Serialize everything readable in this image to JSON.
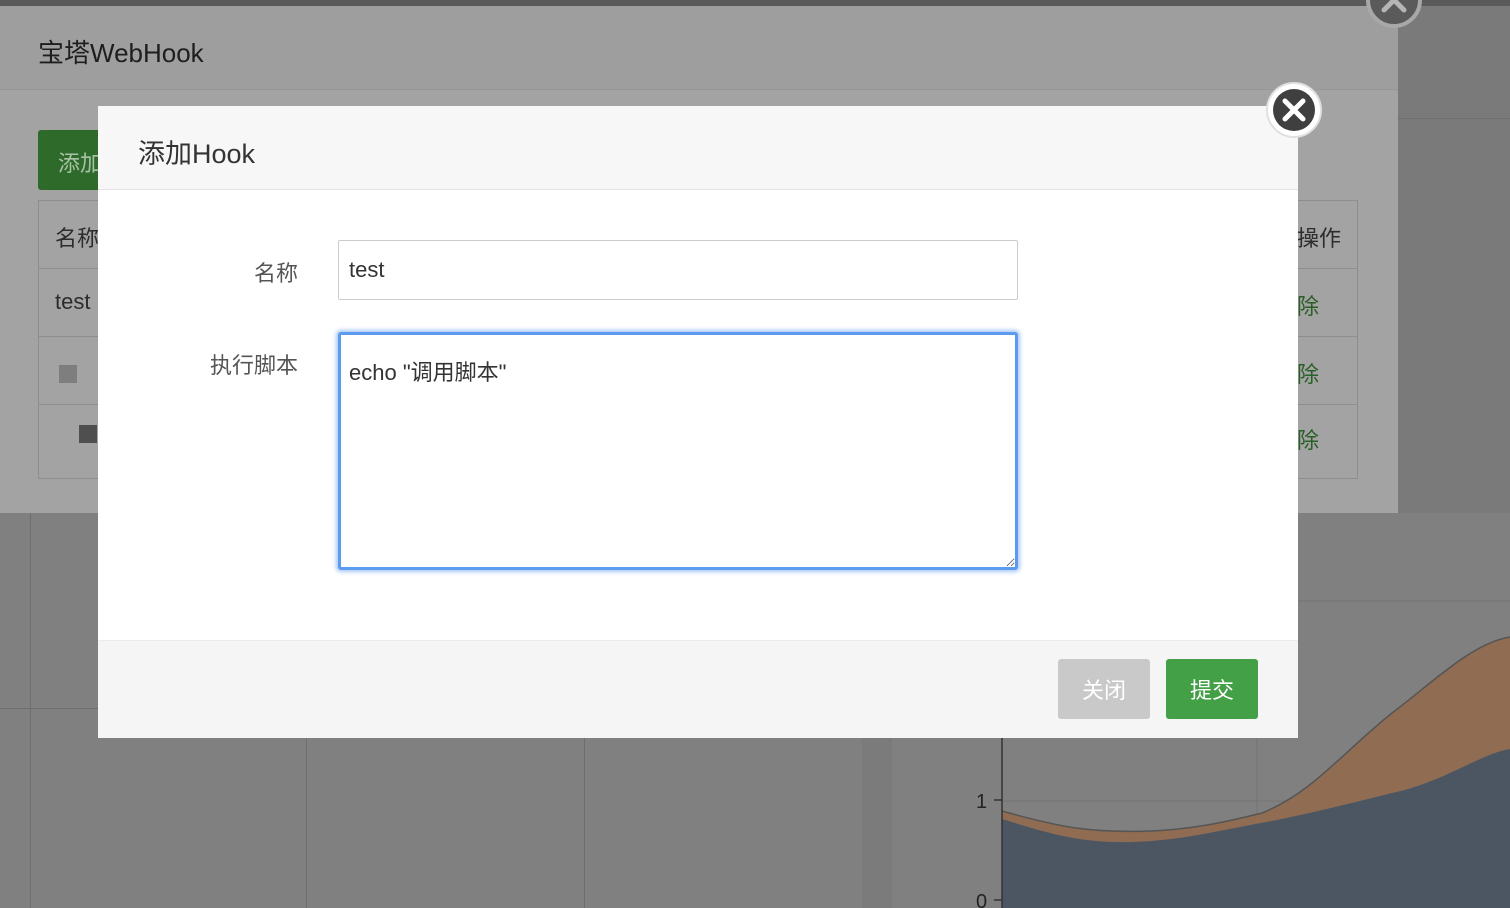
{
  "outer_dialog": {
    "title": "宝塔WebHook",
    "add_button": "添加",
    "table": {
      "header_name": "名称",
      "header_action": "操作",
      "rows": [
        {
          "name": "test",
          "action": "除"
        },
        {
          "name": "",
          "action": "除"
        },
        {
          "name": "",
          "action": "除"
        }
      ]
    }
  },
  "modal": {
    "title": "添加Hook",
    "name_label": "名称",
    "name_value": "test",
    "script_label": "执行脚本",
    "script_value": "echo \"调用脚本\"",
    "close_button": "关闭",
    "submit_button": "提交"
  },
  "chart_data": {
    "type": "area",
    "y_ticks": [
      "0",
      "1"
    ],
    "series": [
      {
        "color": "#8f6c52"
      },
      {
        "color": "#4c5663"
      }
    ]
  },
  "colors": {
    "accent_green": "#43a046",
    "focus_blue": "#5b9bf0"
  }
}
